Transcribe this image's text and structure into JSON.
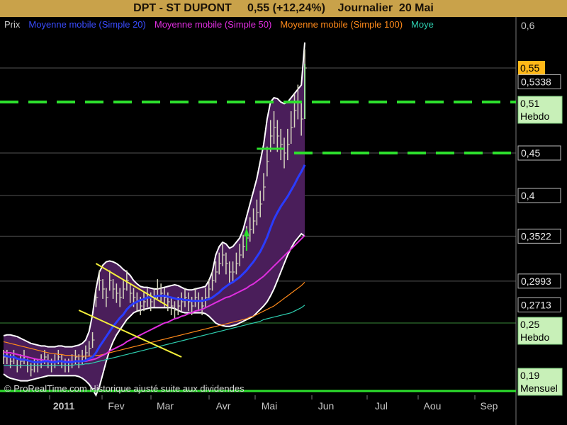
{
  "title": "DPT - ST DUPONT     0,55 (+12,24%)    Journalier  20 Mai",
  "watermark": "© ProRealTime.com Historique ajusté suite aux dividendes",
  "colors": {
    "background": "#000000",
    "title_bar": "#c9a24a",
    "band_fill": "#4a1e5a",
    "band_edge": "#ffffff",
    "price_bar": "#d8d8c0",
    "sma20": "#2a3cff",
    "sma50": "#e02ee0",
    "sma100": "#ff8a1a",
    "sma200": "#2ecfb0",
    "support": "#2de02d",
    "triangle": "#f4ef3a"
  },
  "legend": [
    {
      "label": "Prix",
      "color": "#c8c8c8"
    },
    {
      "label": "Moyenne mobile (Simple 20)",
      "color": "#3a4cff"
    },
    {
      "label": "Moyenne mobile (Simple 50)",
      "color": "#e02ee0"
    },
    {
      "label": "Moyenne mobile (Simple 100)",
      "color": "#ff8a1a"
    },
    {
      "label": "Moye",
      "color": "#2ecfb0"
    }
  ],
  "chart_data": {
    "type": "line",
    "ylim": [
      0.165,
      0.61
    ],
    "yticks": [
      0.6,
      0.55,
      0.5338,
      0.51,
      0.45,
      0.4,
      0.3522,
      0.2993,
      0.2713,
      0.25,
      0.19
    ],
    "x_tick_labels": [
      "2011",
      "Fev",
      "Mar",
      "Avr",
      "Mai",
      "Jun",
      "Jul",
      "Aou",
      "Sep"
    ],
    "axis_labels": [
      {
        "text": "0,6",
        "value": 0.6,
        "style": "plain"
      },
      {
        "text": "0,55",
        "value": 0.55,
        "style": "highlight"
      },
      {
        "text": "0,5338",
        "value": 0.5338,
        "style": "boxed"
      },
      {
        "text": "0,51",
        "sub": "Hebdo",
        "value": 0.51,
        "style": "green"
      },
      {
        "text": "0,45",
        "value": 0.45,
        "style": "boxed"
      },
      {
        "text": "0,4",
        "value": 0.4,
        "style": "boxed"
      },
      {
        "text": "0,3522",
        "value": 0.3522,
        "style": "boxed"
      },
      {
        "text": "0,2993",
        "value": 0.2993,
        "style": "boxed"
      },
      {
        "text": "0,2713",
        "value": 0.2713,
        "style": "boxed"
      },
      {
        "text": "0,25",
        "sub": "Hebdo",
        "value": 0.25,
        "style": "green"
      },
      {
        "text": "0,19",
        "sub": "Mensuel",
        "value": 0.19,
        "style": "green"
      }
    ],
    "horizontal_lines": [
      0.55,
      0.4,
      0.3522,
      0.2993,
      0.25,
      0.45
    ],
    "support_lines": [
      {
        "value": 0.51,
        "dashed": true,
        "x_start": 0,
        "x_end": 1
      },
      {
        "value": 0.45,
        "dashed": true,
        "x_start": 0.57,
        "x_end": 1
      },
      {
        "value": 0.17,
        "dashed": false,
        "x_start": 0,
        "x_end": 1
      }
    ],
    "price_close": [
      0.21,
      0.21,
      0.205,
      0.21,
      0.2,
      0.205,
      0.21,
      0.2,
      0.195,
      0.2,
      0.2,
      0.205,
      0.21,
      0.205,
      0.2,
      0.205,
      0.21,
      0.205,
      0.2,
      0.2,
      0.205,
      0.21,
      0.205,
      0.21,
      0.215,
      0.22,
      0.23,
      0.28,
      0.3,
      0.29,
      0.28,
      0.3,
      0.29,
      0.285,
      0.28,
      0.29,
      0.3,
      0.285,
      0.28,
      0.275,
      0.27,
      0.275,
      0.28,
      0.275,
      0.28,
      0.29,
      0.285,
      0.28,
      0.275,
      0.27,
      0.265,
      0.27,
      0.275,
      0.28,
      0.275,
      0.27,
      0.28,
      0.275,
      0.27,
      0.28,
      0.29,
      0.3,
      0.31,
      0.32,
      0.33,
      0.32,
      0.31,
      0.31,
      0.32,
      0.33,
      0.34,
      0.35,
      0.36,
      0.37,
      0.38,
      0.39,
      0.41,
      0.44,
      0.47,
      0.48,
      0.47,
      0.46,
      0.45,
      0.46,
      0.48,
      0.5,
      0.51,
      0.49,
      0.55
    ],
    "sma20": [
      0.212,
      0.211,
      0.21,
      0.21,
      0.208,
      0.207,
      0.207,
      0.206,
      0.205,
      0.204,
      0.204,
      0.204,
      0.205,
      0.205,
      0.204,
      0.204,
      0.205,
      0.205,
      0.204,
      0.204,
      0.204,
      0.205,
      0.205,
      0.205,
      0.206,
      0.208,
      0.21,
      0.215,
      0.222,
      0.228,
      0.234,
      0.24,
      0.246,
      0.251,
      0.256,
      0.26,
      0.266,
      0.27,
      0.273,
      0.275,
      0.277,
      0.278,
      0.28,
      0.28,
      0.281,
      0.282,
      0.282,
      0.282,
      0.281,
      0.28,
      0.279,
      0.278,
      0.278,
      0.277,
      0.277,
      0.276,
      0.276,
      0.276,
      0.276,
      0.277,
      0.278,
      0.28,
      0.283,
      0.286,
      0.29,
      0.293,
      0.296,
      0.298,
      0.301,
      0.304,
      0.308,
      0.312,
      0.317,
      0.322,
      0.328,
      0.334,
      0.342,
      0.351,
      0.362,
      0.372,
      0.38,
      0.387,
      0.393,
      0.399,
      0.406,
      0.413,
      0.421,
      0.428,
      0.436
    ],
    "sma50": [
      0.216,
      0.215,
      0.215,
      0.214,
      0.213,
      0.212,
      0.211,
      0.21,
      0.209,
      0.208,
      0.207,
      0.207,
      0.206,
      0.206,
      0.205,
      0.205,
      0.205,
      0.205,
      0.205,
      0.205,
      0.205,
      0.205,
      0.205,
      0.205,
      0.205,
      0.206,
      0.207,
      0.208,
      0.21,
      0.212,
      0.214,
      0.217,
      0.219,
      0.221,
      0.223,
      0.225,
      0.228,
      0.23,
      0.232,
      0.234,
      0.236,
      0.238,
      0.24,
      0.242,
      0.244,
      0.246,
      0.248,
      0.25,
      0.251,
      0.253,
      0.255,
      0.256,
      0.258,
      0.259,
      0.261,
      0.262,
      0.264,
      0.265,
      0.266,
      0.268,
      0.27,
      0.272,
      0.274,
      0.276,
      0.278,
      0.28,
      0.281,
      0.283,
      0.285,
      0.287,
      0.289,
      0.291,
      0.294,
      0.296,
      0.299,
      0.302,
      0.305,
      0.309,
      0.313,
      0.317,
      0.321,
      0.325,
      0.329,
      0.333,
      0.337,
      0.341,
      0.345,
      0.349,
      0.353
    ],
    "sma100": [
      0.228,
      0.227,
      0.226,
      0.225,
      0.224,
      0.223,
      0.222,
      0.221,
      0.22,
      0.219,
      0.218,
      0.217,
      0.216,
      0.215,
      0.214,
      0.214,
      0.213,
      0.213,
      0.212,
      0.212,
      0.212,
      0.211,
      0.211,
      0.211,
      0.211,
      0.211,
      0.211,
      0.212,
      0.212,
      0.213,
      0.214,
      0.215,
      0.216,
      0.217,
      0.218,
      0.219,
      0.22,
      0.221,
      0.222,
      0.223,
      0.224,
      0.225,
      0.226,
      0.227,
      0.228,
      0.229,
      0.23,
      0.231,
      0.232,
      0.233,
      0.234,
      0.235,
      0.236,
      0.237,
      0.238,
      0.239,
      0.24,
      0.241,
      0.242,
      0.243,
      0.244,
      0.245,
      0.246,
      0.247,
      0.248,
      0.249,
      0.25,
      0.251,
      0.252,
      0.253,
      0.254,
      0.255,
      0.257,
      0.258,
      0.26,
      0.262,
      0.264,
      0.266,
      0.268,
      0.27,
      0.273,
      0.276,
      0.279,
      0.282,
      0.285,
      0.288,
      0.291,
      0.294,
      0.298
    ],
    "sma200": [
      0.2,
      0.2,
      0.2,
      0.2,
      0.2,
      0.2,
      0.2,
      0.2,
      0.2,
      0.2,
      0.2,
      0.2,
      0.2,
      0.2,
      0.2,
      0.2,
      0.2,
      0.2,
      0.2,
      0.2,
      0.2,
      0.201,
      0.201,
      0.201,
      0.202,
      0.202,
      0.203,
      0.204,
      0.205,
      0.206,
      0.207,
      0.208,
      0.209,
      0.21,
      0.211,
      0.212,
      0.213,
      0.214,
      0.215,
      0.216,
      0.217,
      0.218,
      0.219,
      0.22,
      0.221,
      0.222,
      0.223,
      0.224,
      0.225,
      0.226,
      0.227,
      0.228,
      0.229,
      0.23,
      0.231,
      0.232,
      0.233,
      0.234,
      0.235,
      0.236,
      0.237,
      0.238,
      0.239,
      0.24,
      0.241,
      0.242,
      0.243,
      0.244,
      0.245,
      0.246,
      0.247,
      0.248,
      0.249,
      0.25,
      0.251,
      0.252,
      0.254,
      0.255,
      0.256,
      0.257,
      0.258,
      0.259,
      0.26,
      0.261,
      0.262,
      0.264,
      0.266,
      0.268,
      0.271
    ],
    "band_upper": [
      0.235,
      0.236,
      0.236,
      0.235,
      0.234,
      0.232,
      0.23,
      0.228,
      0.226,
      0.225,
      0.224,
      0.223,
      0.223,
      0.222,
      0.222,
      0.222,
      0.223,
      0.223,
      0.222,
      0.222,
      0.222,
      0.223,
      0.224,
      0.226,
      0.23,
      0.24,
      0.26,
      0.29,
      0.31,
      0.318,
      0.322,
      0.323,
      0.322,
      0.32,
      0.317,
      0.313,
      0.31,
      0.306,
      0.3,
      0.296,
      0.293,
      0.292,
      0.292,
      0.291,
      0.29,
      0.29,
      0.291,
      0.292,
      0.293,
      0.294,
      0.295,
      0.294,
      0.292,
      0.29,
      0.289,
      0.289,
      0.29,
      0.291,
      0.292,
      0.293,
      0.3,
      0.31,
      0.33,
      0.34,
      0.345,
      0.343,
      0.338,
      0.34,
      0.345,
      0.35,
      0.36,
      0.375,
      0.39,
      0.405,
      0.42,
      0.44,
      0.46,
      0.49,
      0.51,
      0.515,
      0.514,
      0.51,
      0.508,
      0.51,
      0.515,
      0.52,
      0.525,
      0.53,
      0.58
    ],
    "band_lower": [
      0.19,
      0.187,
      0.185,
      0.184,
      0.183,
      0.182,
      0.182,
      0.182,
      0.183,
      0.184,
      0.185,
      0.186,
      0.187,
      0.188,
      0.188,
      0.188,
      0.188,
      0.188,
      0.188,
      0.188,
      0.188,
      0.188,
      0.187,
      0.185,
      0.182,
      0.178,
      0.172,
      0.165,
      0.175,
      0.19,
      0.205,
      0.218,
      0.228,
      0.236,
      0.242,
      0.248,
      0.254,
      0.258,
      0.262,
      0.264,
      0.265,
      0.266,
      0.267,
      0.268,
      0.268,
      0.268,
      0.268,
      0.268,
      0.268,
      0.268,
      0.267,
      0.265,
      0.263,
      0.262,
      0.262,
      0.262,
      0.262,
      0.262,
      0.262,
      0.261,
      0.258,
      0.254,
      0.25,
      0.248,
      0.247,
      0.246,
      0.246,
      0.247,
      0.248,
      0.25,
      0.252,
      0.254,
      0.256,
      0.258,
      0.262,
      0.266,
      0.27,
      0.275,
      0.282,
      0.29,
      0.3,
      0.31,
      0.32,
      0.33,
      0.338,
      0.345,
      0.35,
      0.355,
      0.352
    ]
  }
}
